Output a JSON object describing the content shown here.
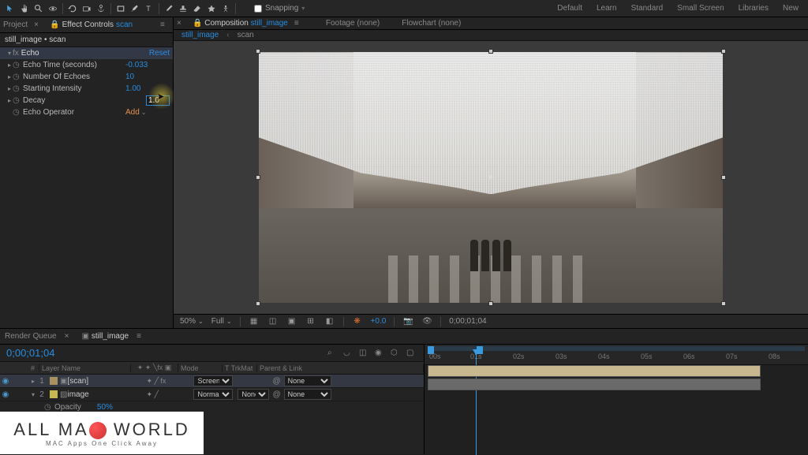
{
  "toolbar": {
    "snapping_label": "Snapping"
  },
  "workspace_tabs": [
    "Default",
    "Learn",
    "Standard",
    "Small Screen",
    "Libraries",
    "New"
  ],
  "left_panel": {
    "tab_project": "Project",
    "tab_effect": "Effect Controls",
    "tab_effect_target": "scan",
    "breadcrumb": "still_image • scan",
    "effect": {
      "name": "Echo",
      "reset": "Reset",
      "params": [
        {
          "label": "Echo Time (seconds)",
          "value": "-0.033"
        },
        {
          "label": "Number Of Echoes",
          "value": "10"
        },
        {
          "label": "Starting Intensity",
          "value": "1.00"
        },
        {
          "label": "Decay",
          "value": "1.0",
          "editing": true
        },
        {
          "label": "Echo Operator",
          "value": "Add",
          "dropdown": true
        }
      ]
    }
  },
  "center": {
    "tab_composition": "Composition",
    "tab_comp_target": "still_image",
    "tab_footage": "Footage (none)",
    "tab_flowchart": "Flowchart (none)",
    "subtab_active": "still_image",
    "subtab_other": "scan",
    "viewbar": {
      "zoom": "50%",
      "res": "Full",
      "exposure": "+0.0",
      "timecode": "0;00;01;04"
    }
  },
  "timeline": {
    "tab_render": "Render Queue",
    "tab_comp": "still_image",
    "timecode": "0;00;01;04",
    "col_layer": "Layer Name",
    "col_mode": "Mode",
    "col_trk": "TrkMat",
    "col_parent": "Parent & Link",
    "layers": [
      {
        "num": "1",
        "name": "[scan]",
        "mode": "Screen",
        "trk": "",
        "parent": "None"
      },
      {
        "num": "2",
        "name": "image",
        "mode": "Normal",
        "trk": "None",
        "parent": "None"
      }
    ],
    "sub_prop": {
      "label": "Opacity",
      "value": "50%"
    },
    "ruler": [
      "00s",
      "01s",
      "02s",
      "03s",
      "04s",
      "05s",
      "06s",
      "07s",
      "08s"
    ]
  },
  "watermark": {
    "line1_a": "ALL MA",
    "line1_b": " WORLD",
    "line2": "MAC Apps One Click Away"
  }
}
